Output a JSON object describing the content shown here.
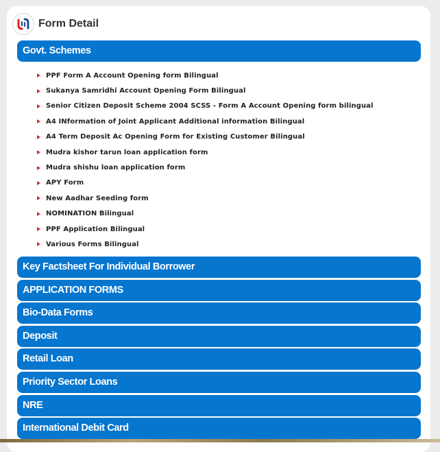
{
  "header": {
    "title": "Form Detail",
    "logo_icon": "union-bank-logo-icon"
  },
  "expanded_section": {
    "title": "Govt. Schemes",
    "items": [
      "PPF Form A Account Opening form Bilingual",
      "Sukanya Samridhi Account Opening Form Bilingual",
      "Senior Citizen Deposit Scheme 2004 SCSS - Form A Account Opening form bilingual",
      "A4 INformation of Joint Applicant Additional information Bilingual",
      "A4 Term Deposit Ac Opening Form for Existing Customer Bilingual",
      "Mudra kishor tarun loan application form",
      "Mudra shishu loan application form",
      "APY Form",
      "New Aadhar Seeding form",
      "NOMINATION Bilingual",
      "PPF Application Bilingual",
      "Various Forms Bilingual"
    ]
  },
  "collapsed_sections": [
    "Key Factsheet For Individual Borrower",
    "APPLICATION FORMS",
    "Bio-Data Forms",
    "Deposit",
    "Retail Loan",
    "Priority Sector Loans",
    "NRE",
    "International Debit Card"
  ],
  "colors": {
    "accent": "#0676cf",
    "bullet": "#d8262c",
    "logo_red": "#e2231a",
    "logo_blue": "#1d4f91"
  }
}
